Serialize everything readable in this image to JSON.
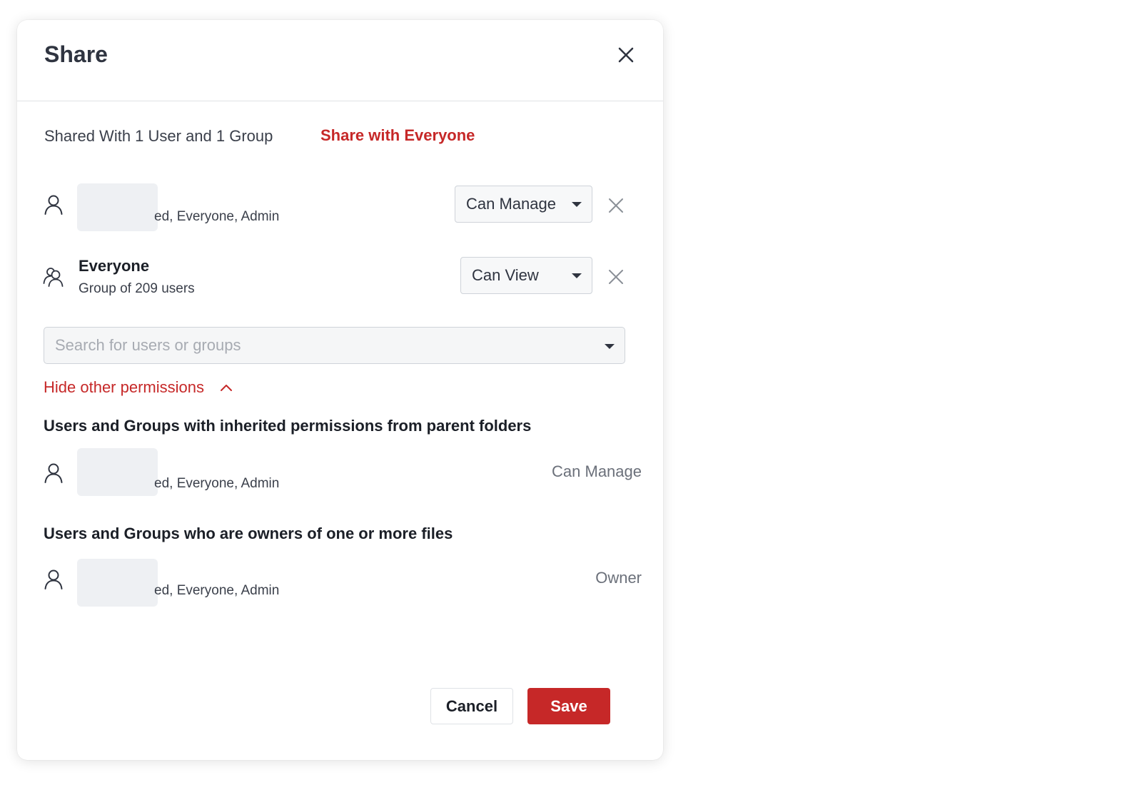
{
  "dialog": {
    "title": "Share",
    "close_icon": "close-icon"
  },
  "summary": {
    "shared_with": "Shared With 1 User and 1 Group",
    "share_everyone_link": "Share with Everyone"
  },
  "shared_entries": [
    {
      "icon": "user-icon",
      "name": "",
      "subtext": "ed, Everyone, Admin",
      "permission": "Can Manage",
      "remove_icon": "remove-icon"
    },
    {
      "icon": "group-icon",
      "name": "Everyone",
      "subtext": "Group of 209 users",
      "permission": "Can View",
      "remove_icon": "remove-icon"
    }
  ],
  "search": {
    "value": "",
    "placeholder": "Search for users or groups"
  },
  "toggle_other_permissions": {
    "label": "Hide other permissions",
    "icon": "chevron-up-icon"
  },
  "inherited_section": {
    "heading": "Users and Groups with inherited permissions from parent folders",
    "entries": [
      {
        "icon": "user-icon",
        "subtext": "ed, Everyone, Admin",
        "permission": "Can Manage"
      }
    ]
  },
  "owners_section": {
    "heading": "Users and Groups who are owners of one or more files",
    "entries": [
      {
        "icon": "user-icon",
        "subtext": "ed, Everyone, Admin",
        "permission": "Owner"
      }
    ]
  },
  "footer": {
    "cancel_label": "Cancel",
    "save_label": "Save"
  },
  "colors": {
    "accent": "#c62828",
    "text": "#1f2430",
    "muted": "#6b707a",
    "border": "#cfd3d9"
  }
}
